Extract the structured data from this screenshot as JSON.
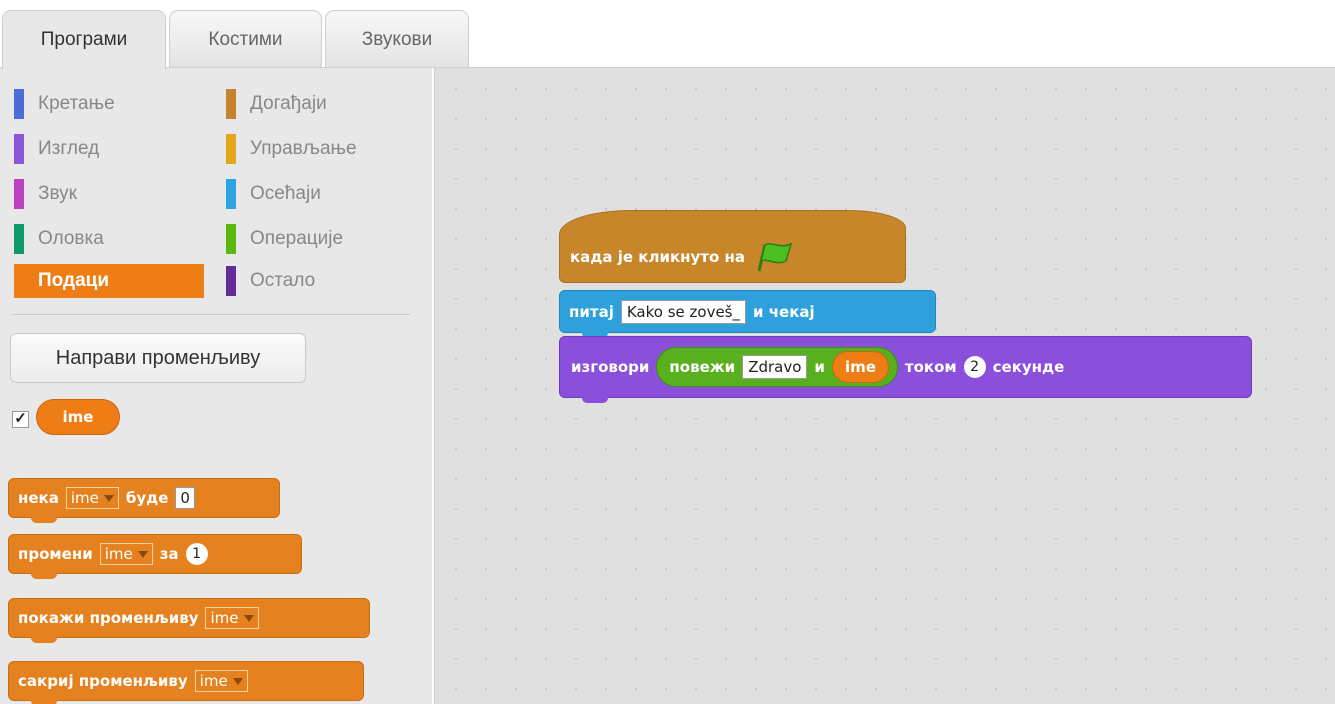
{
  "tabs": [
    {
      "label": "Програми",
      "active": true
    },
    {
      "label": "Костими",
      "active": false
    },
    {
      "label": "Звукови",
      "active": false
    }
  ],
  "categories": {
    "left": [
      {
        "label": "Кретање",
        "color": "#4a6cd4"
      },
      {
        "label": "Изглед",
        "color": "#8a55d7"
      },
      {
        "label": "Звук",
        "color": "#bb42c3"
      },
      {
        "label": "Оловка",
        "color": "#0e9a6c"
      },
      {
        "label": "Подаци",
        "color": "#ee7d16",
        "selected": true
      }
    ],
    "right": [
      {
        "label": "Догађаји",
        "color": "#c88330"
      },
      {
        "label": "Управљање",
        "color": "#e1a91a"
      },
      {
        "label": "Осећаји",
        "color": "#2ca5e2"
      },
      {
        "label": "Операције",
        "color": "#5cb712"
      },
      {
        "label": "Остало",
        "color": "#632d99"
      }
    ]
  },
  "palette": {
    "make_variable": "Направи променљиву",
    "variable": {
      "name": "ime",
      "checked": true
    },
    "blocks": {
      "set": {
        "label": "нека",
        "var": "ime",
        "to": "буде",
        "value": "0"
      },
      "change": {
        "label": "промени",
        "var": "ime",
        "by": "за",
        "value": "1"
      },
      "show": {
        "label": "покажи променљиву",
        "var": "ime"
      },
      "hide": {
        "label": "сакриј променљиву",
        "var": "ime"
      }
    }
  },
  "script": {
    "when_flag": "када је кликнуто на",
    "ask": {
      "label": "питај",
      "question": "Kako se zoveš_",
      "wait": "и чекај"
    },
    "say": {
      "label": "изговори",
      "join": "повежи",
      "join_text": "Zdravo",
      "and": "и",
      "var": "ime",
      "for": "током",
      "seconds": "2",
      "seconds_label": "секунде"
    }
  },
  "colors": {
    "data": "#ee7d16",
    "events": "#c8862b",
    "sensing": "#2ea1dd",
    "looks": "#8a4fdb",
    "operators": "#58b01e"
  }
}
